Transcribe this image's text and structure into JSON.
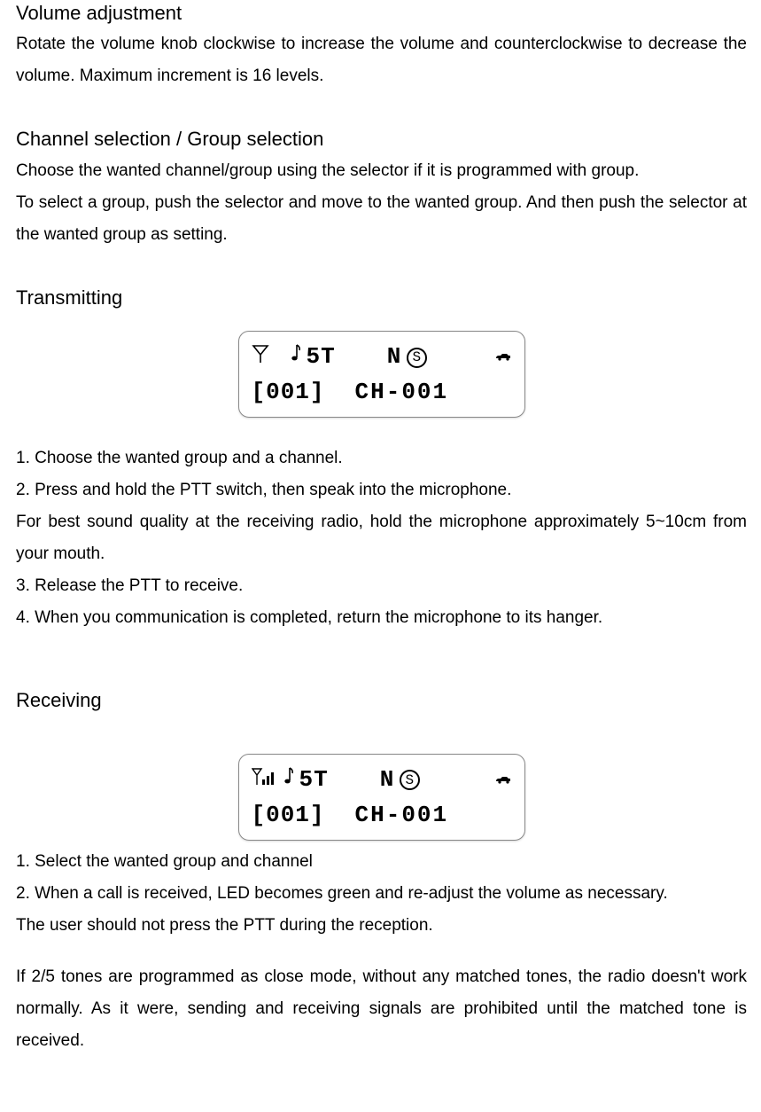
{
  "sections": {
    "volume": {
      "title": "Volume adjustment",
      "body": "Rotate the volume knob clockwise to increase the volume and counterclockwise to decrease the volume. Maximum increment is 16 levels."
    },
    "channel": {
      "title": "Channel selection / Group selection",
      "body1": "Choose the wanted channel/group using the selector if it is programmed with group.",
      "body2": "To select a group, push the selector and move to the wanted group. And then push the selector at the wanted group as setting."
    },
    "transmitting": {
      "title": "Transmitting",
      "lcd": {
        "antenna": "antenna-icon",
        "note": "♪",
        "fivet": "5T",
        "n": "N",
        "s": "S",
        "group": "[001]",
        "channel": "CH-001"
      },
      "steps": {
        "s1": "1.    Choose the wanted group and a channel.",
        "s2": "2.    Press and hold the PTT switch, then speak into the microphone.",
        "s_note": "For best sound quality at the receiving radio, hold the microphone approximately 5~10cm from your mouth.",
        "s3": "3.    Release the PTT to receive.",
        "s4": "4.    When you communication is completed, return the microphone to its hanger."
      }
    },
    "receiving": {
      "title": "Receiving",
      "lcd": {
        "antenna": "antenna-bars-icon",
        "note": "♪",
        "fivet": "5T",
        "n": "N",
        "s": "S",
        "group": "[001]",
        "channel": "CH-001"
      },
      "steps": {
        "s1": "1.    Select the wanted group and channel",
        "s2": "2.    When a call is received, LED becomes green and re-adjust the volume as necessary.",
        "s_note1": "The user should not press the PTT during the reception.",
        "s_note2": "If 2/5 tones are programmed as close mode, without any matched tones, the radio doesn't work normally. As it were, sending and receiving signals are prohibited until the matched tone is received."
      }
    }
  }
}
